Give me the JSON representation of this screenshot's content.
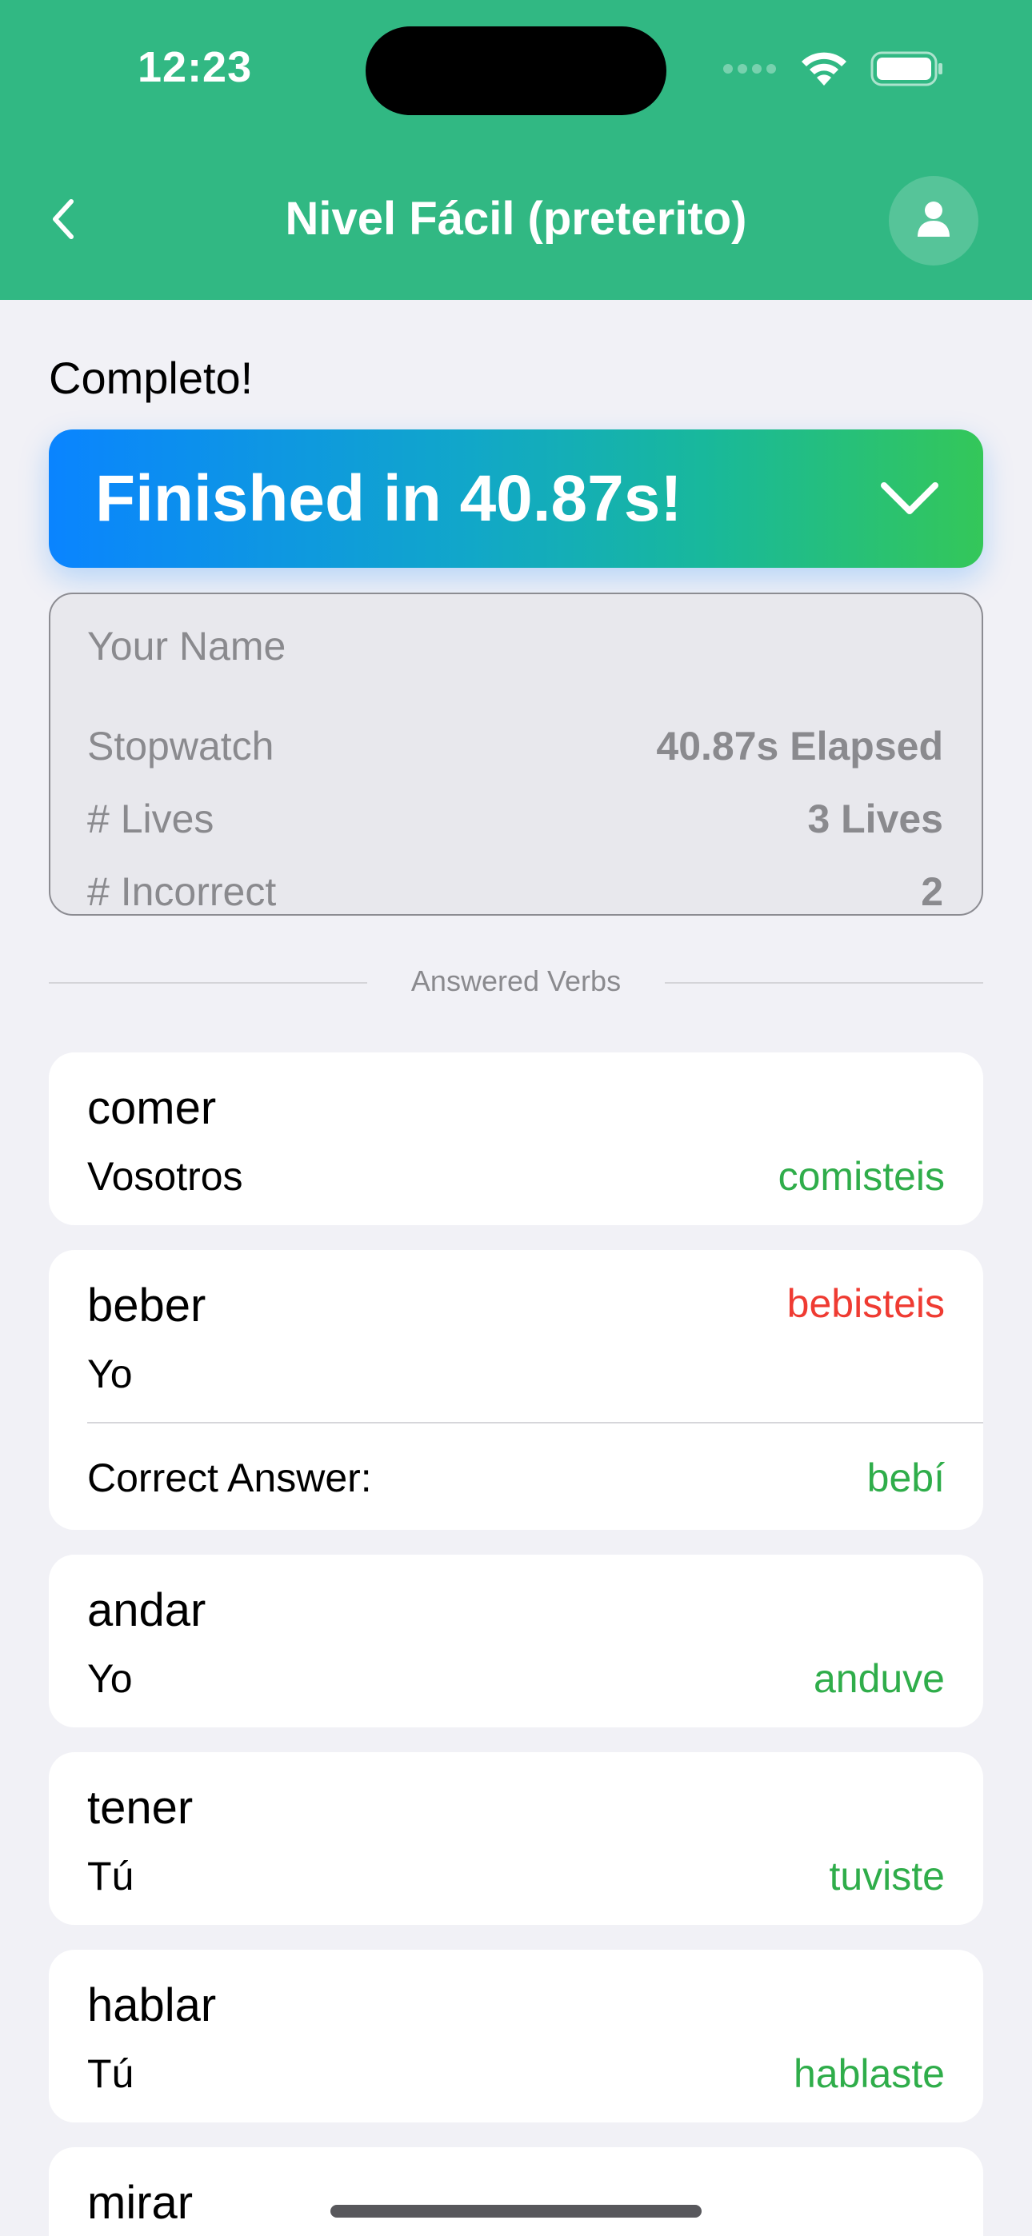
{
  "status_bar": {
    "time": "12:23"
  },
  "nav": {
    "title": "Nivel Fácil (preterito)",
    "back_icon": "chevron-left-icon",
    "profile_icon": "person-icon"
  },
  "summary": {
    "heading": "Completo!",
    "banner_text": "Finished in 40.87s!",
    "name_placeholder": "Your Name",
    "name_value": "",
    "stats": [
      {
        "label": "Stopwatch",
        "value": "40.87s Elapsed"
      },
      {
        "label": "# Lives",
        "value": "3 Lives"
      },
      {
        "label": "# Incorrect",
        "value": "2"
      }
    ]
  },
  "answered": {
    "section_label": "Answered Verbs",
    "correct_label": "Correct Answer:",
    "verbs": [
      {
        "infinitive": "comer",
        "pronoun": "Vosotros",
        "answer": "comisteis",
        "status": "correct"
      },
      {
        "infinitive": "beber",
        "pronoun": "Yo",
        "answer": "bebisteis",
        "status": "incorrect",
        "correct_answer": "bebí"
      },
      {
        "infinitive": "andar",
        "pronoun": "Yo",
        "answer": "anduve",
        "status": "correct"
      },
      {
        "infinitive": "tener",
        "pronoun": "Tú",
        "answer": "tuviste",
        "status": "correct"
      },
      {
        "infinitive": "hablar",
        "pronoun": "Tú",
        "answer": "hablaste",
        "status": "correct"
      },
      {
        "infinitive": "mirar"
      }
    ]
  },
  "colors": {
    "header": "#31b883",
    "correct": "#2fad4a",
    "incorrect": "#ef3b32",
    "background": "#f1f1f6"
  }
}
